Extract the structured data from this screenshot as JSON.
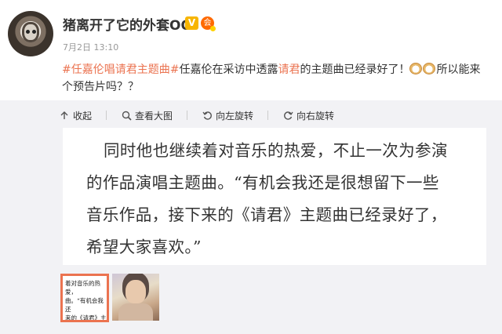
{
  "post": {
    "username": "猪离开了它的外套OO",
    "vip_badge": "V",
    "level_badge": "会",
    "timestamp": "7月2日 13:10",
    "text_parts": {
      "topic": "#任嘉伦唱请君主题曲#",
      "before_keyword": "任嘉伦在采访中透露",
      "keyword": "请君",
      "after_keyword": "的主题曲已经录好了！",
      "after_emoji": "所以能来个预告片吗？？"
    },
    "emoji_count": 2
  },
  "toolbar": {
    "collapse_label": "收起",
    "view_large_label": "查看大图",
    "rotate_left_label": "向左旋转",
    "rotate_right_label": "向右旋转",
    "icons": [
      "collapse-icon",
      "zoom-icon",
      "rotate-left-icon",
      "rotate-right-icon"
    ]
  },
  "image": {
    "line1": "同时他也继续着对音乐的热爱，不止一次为参演",
    "line2": "的作品演唱主题曲。“有机会我还是很想留下一些",
    "line3": "音乐作品，接下来的《请君》主题曲已经录好了，",
    "line4": "希望大家喜欢。”"
  },
  "thumbnails": {
    "text_thumb": {
      "line1": "着对音乐的热爱，",
      "line2": "曲。“有机会我还",
      "line3": "来的《请君》主题"
    }
  },
  "colors": {
    "link": "#eb7350",
    "vip": "#f7b500",
    "media_bg": "#f2f2f5"
  }
}
